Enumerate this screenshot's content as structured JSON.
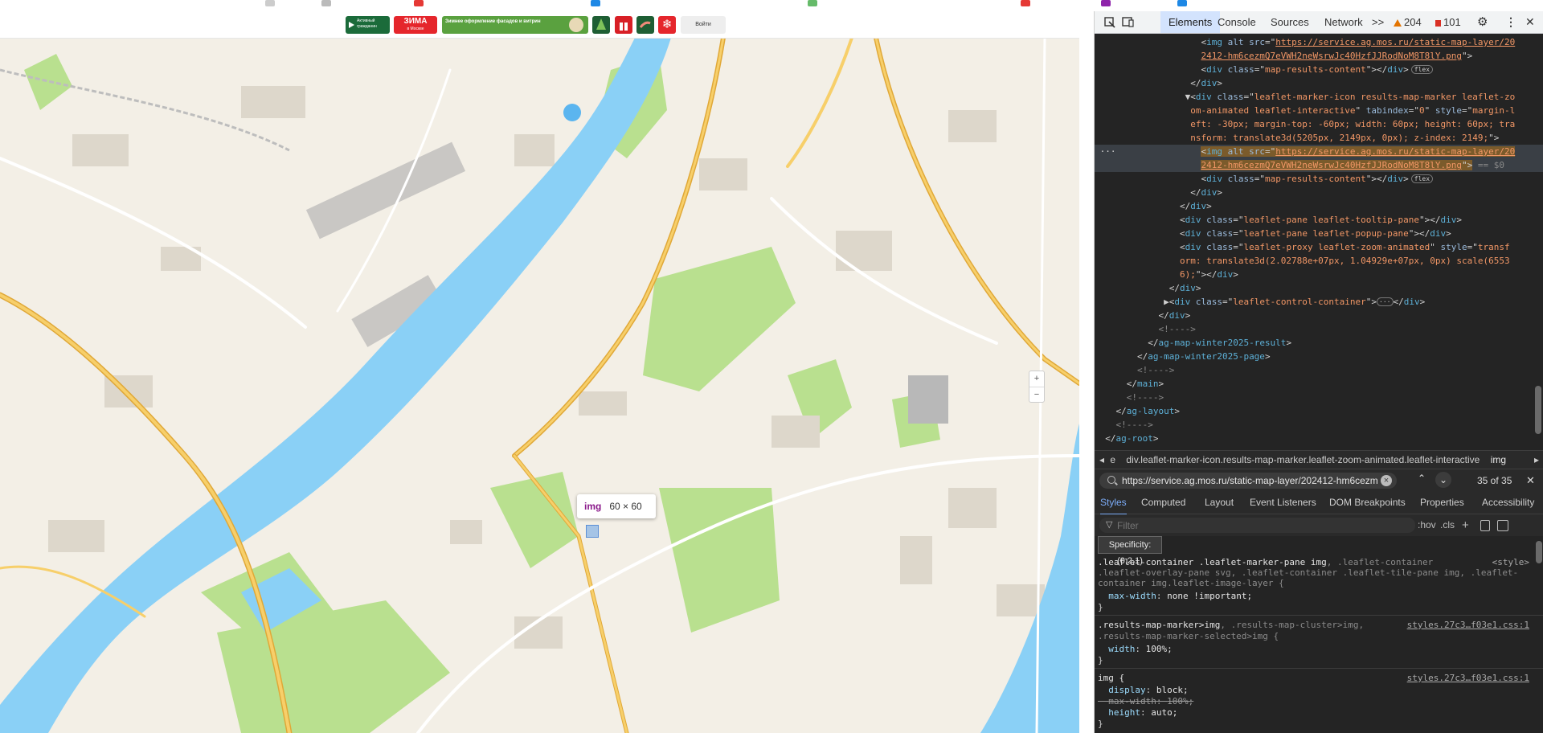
{
  "colors": {
    "land": "#f3efe6",
    "water": "#8ad0f6",
    "park": "#b9e08f",
    "road_major": "#f4c35a",
    "road_border": "#e0a838",
    "building": "#ddd7cb",
    "devtools_bg": "#242424",
    "accent": "#7cacf8"
  },
  "site_header": {
    "logo_text": "Активный гражданин",
    "winter_title": "ЗИМА",
    "winter_sub": "в Москве",
    "facades_text": "Зимнее оформление фасадов и витрин",
    "snowflake": "❄",
    "login_label": "Войти"
  },
  "map": {
    "zoom_in": "+",
    "zoom_out": "−",
    "tooltip_tag": "img",
    "tooltip_size": "60 × 60"
  },
  "devtools": {
    "tabs": {
      "elements": "Elements",
      "console": "Console",
      "sources": "Sources",
      "network": "Network",
      "more": ">>",
      "warnings": "204",
      "errors": "101"
    },
    "breadcrumb": {
      "prev": "e",
      "path": "div.leaflet-marker-icon.results-map-marker.leaflet-zoom-animated.leaflet-interactive",
      "current": "img"
    },
    "search": {
      "value": "https://service.ag.mos.ru/static-map-layer/202412-hm6cezmQ7eV",
      "count": "35 of 35"
    },
    "subtabs": [
      "Styles",
      "Computed",
      "Layout",
      "Event Listeners",
      "DOM Breakpoints",
      "Properties",
      "Accessibility"
    ],
    "filter_placeholder": "Filter",
    "filter_tools": {
      "hov": ":hov",
      "cls": ".cls"
    },
    "specificity": "Specificity: (0,2,1)",
    "rules": {
      "r1_sel_a": ".leaflet-container .leaflet-marker-pane img",
      "r1_sel_b": ", .leaflet-container",
      "r1_src": "<style>",
      "r1_l2": ".leaflet-overlay-pane svg, .leaflet-container .leaflet-tile-pane img, .leaflet-",
      "r1_l3": "container img.leaflet-image-layer {",
      "r1_prop": "max-width",
      "r1_val": "none !important;",
      "r2_sel_a": ".results-map-marker>img",
      "r2_sel_b": ", .results-map-cluster>img,",
      "r2_l2": ".results-map-marker-selected>img {",
      "r2_src": "styles.27c3…f03e1.css:1",
      "r2_prop": "width",
      "r2_val": "100%;",
      "r3_sel": "img {",
      "r3_src": "styles.27c3…f03e1.css:1",
      "r3_p1": "display",
      "r3_v1": "block;",
      "r3_p2": "max-width",
      "r3_v2": "100%;",
      "r3_p3": "height",
      "r3_v3": "auto;",
      "close": "}"
    }
  }
}
